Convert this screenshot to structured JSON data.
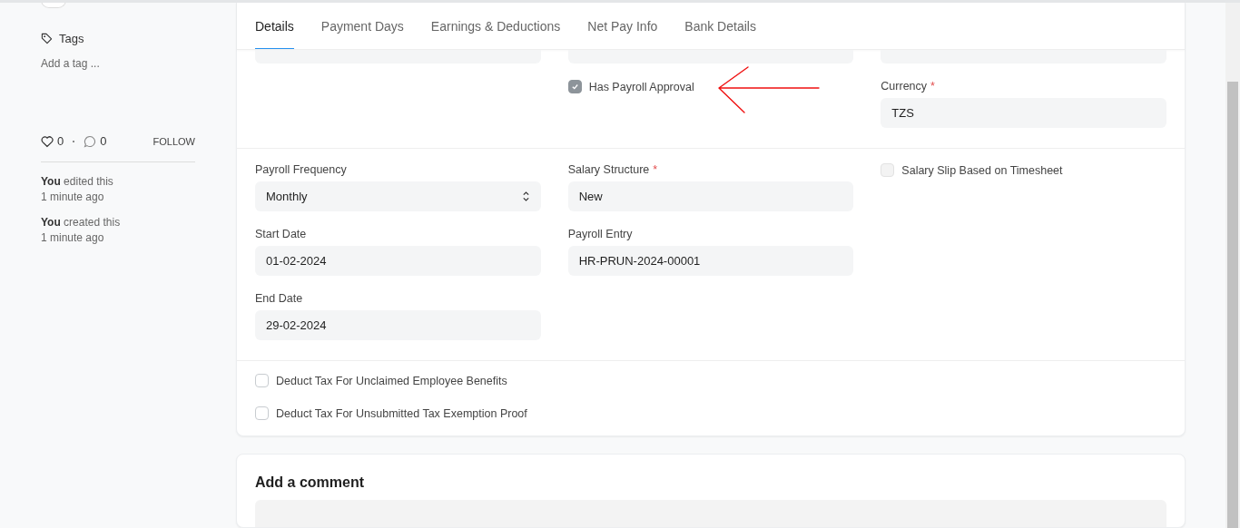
{
  "sidebar": {
    "tags_label": "Tags",
    "tag_placeholder": "Add a tag ...",
    "likes": "0",
    "comments": "0",
    "follow": "FOLLOW",
    "activity": [
      {
        "text": "**You** edited this",
        "time": "1 minute ago"
      },
      {
        "text": "**You** created this",
        "time": "1 minute ago"
      }
    ]
  },
  "tabs": [
    {
      "label": "Details",
      "selected": true
    },
    {
      "label": "Payment Days",
      "selected": false
    },
    {
      "label": "Earnings & Deductions",
      "selected": false
    },
    {
      "label": "Net Pay Info",
      "selected": false
    },
    {
      "label": "Bank Details",
      "selected": false
    }
  ],
  "sections": [
    {
      "columns": [
        [],
        [
          {
            "kind": "check",
            "label": "Has Payroll Approval",
            "checked": true
          }
        ],
        [
          {
            "kind": "field",
            "label": "Currency",
            "required_mark": "*",
            "value": "TZS"
          }
        ]
      ]
    },
    {
      "columns": [
        [
          {
            "kind": "select",
            "label": "Payroll Frequency",
            "value": "Monthly"
          },
          {
            "kind": "field",
            "label": "Start Date",
            "value": "01-02-2024"
          },
          {
            "kind": "field",
            "label": "End Date",
            "value": "29-02-2024"
          }
        ],
        [
          {
            "kind": "field",
            "label": "Salary Structure",
            "required_mark": "*",
            "value": "New"
          },
          {
            "kind": "field",
            "label": "Payroll Entry",
            "value": "HR-PRUN-2024-00001"
          }
        ],
        [
          {
            "kind": "check",
            "label": "Salary Slip Based on Timesheet",
            "checked": false
          }
        ]
      ]
    },
    {
      "columns": [
        [
          {
            "kind": "check",
            "label": "Deduct Tax For Unclaimed Employee Benefits",
            "checked": false
          },
          {
            "kind": "check",
            "label": "Deduct Tax For Unsubmitted Tax Exemption Proof",
            "checked": false
          }
        ]
      ]
    }
  ],
  "comment": {
    "title": "Add a comment"
  }
}
